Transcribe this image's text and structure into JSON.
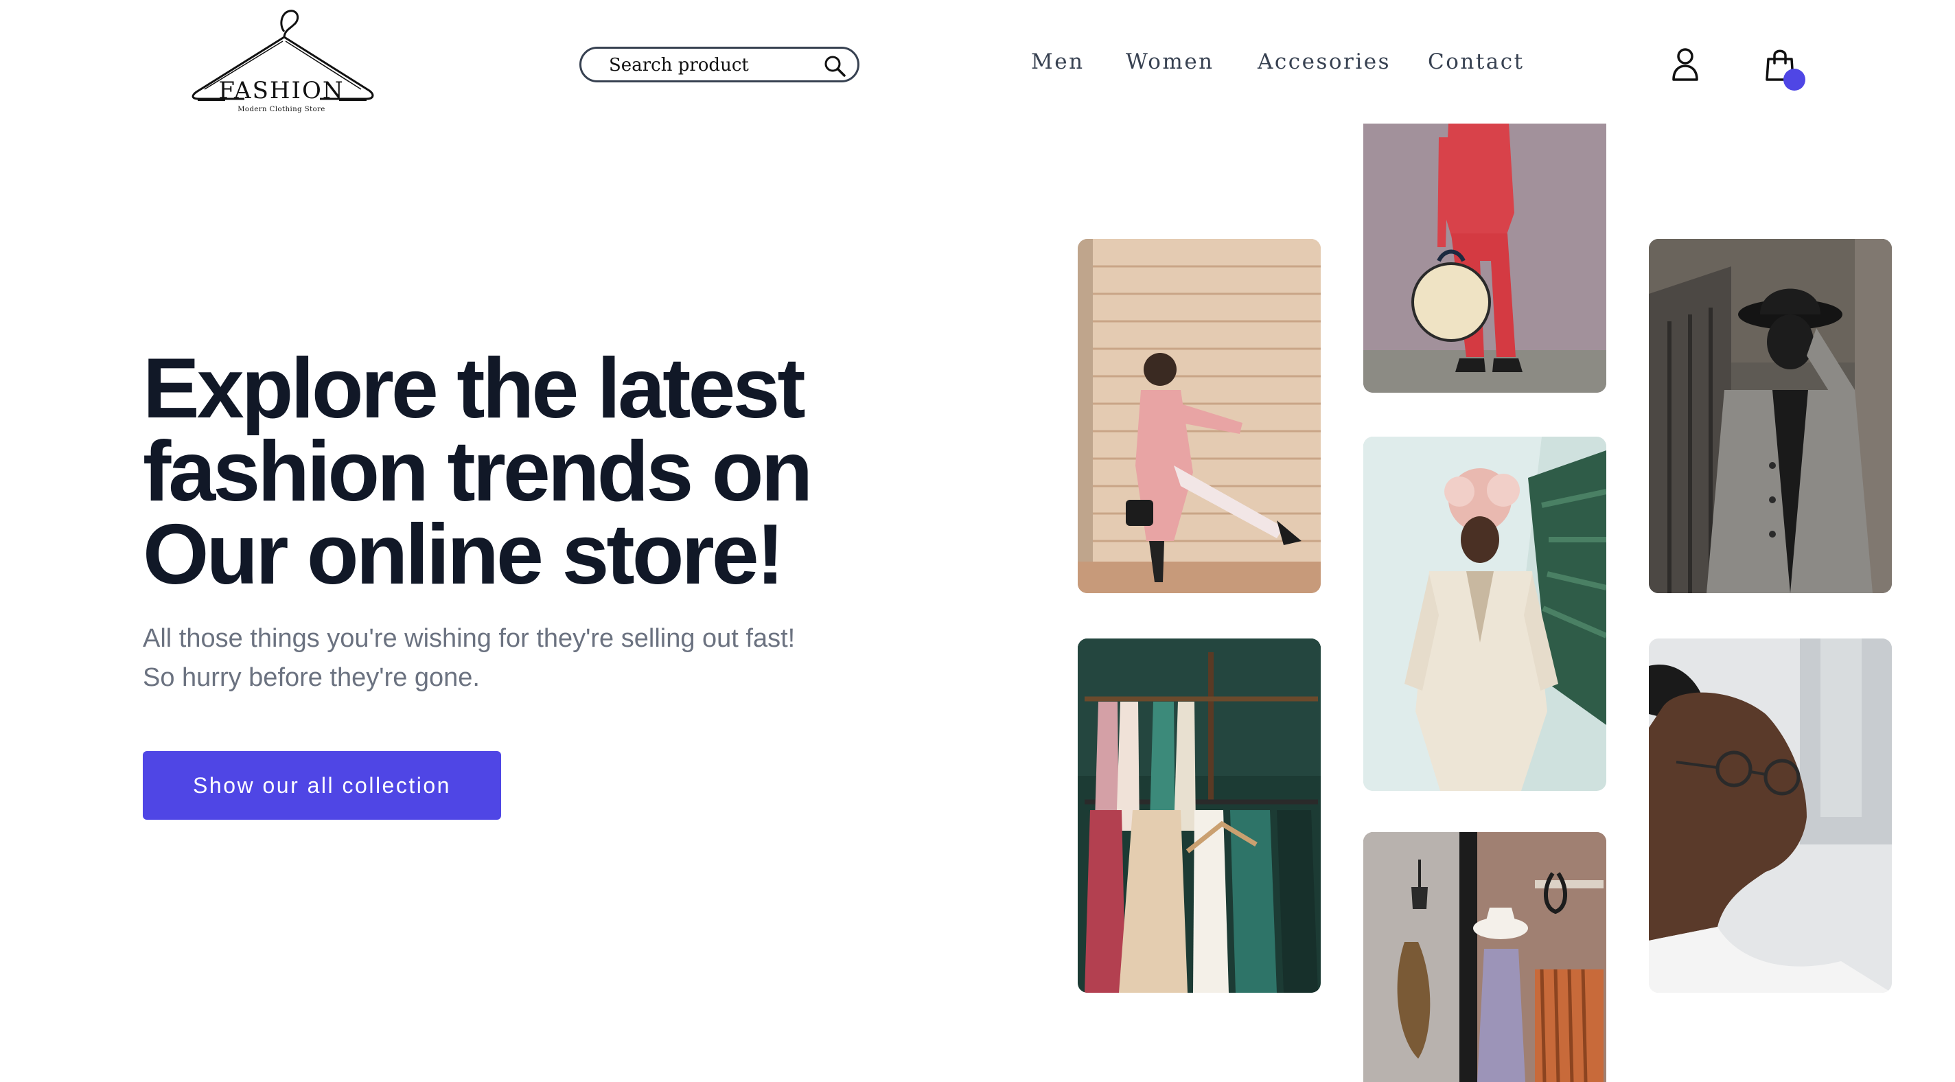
{
  "brand": {
    "name": "FASHION",
    "tagline": "Modern Clothing Store",
    "logo_icon": "hanger-icon"
  },
  "search": {
    "placeholder": "Search product",
    "icon": "search-icon"
  },
  "nav": {
    "items": [
      {
        "label": "Men"
      },
      {
        "label": "Women"
      },
      {
        "label": "Accesories"
      },
      {
        "label": "Contact"
      }
    ]
  },
  "header_icons": {
    "user": "user-icon",
    "cart": "shopping-bag-icon",
    "cart_badge_color": "#4f46e5"
  },
  "hero": {
    "title_lines": [
      "Explore the latest",
      "fashion trends on",
      "Our online store!"
    ],
    "subtitle_lines": [
      "All those things you're wishing for they're selling out fast!",
      "So hurry before they're gone."
    ],
    "cta_label": "Show our all collection"
  },
  "colors": {
    "accent": "#4f46e5",
    "heading": "#111827",
    "muted_text": "#6b7280"
  },
  "gallery": [
    {
      "subject": "woman in pink coat kicking against striped wall"
    },
    {
      "subject": "person in red suit holding round straw bag"
    },
    {
      "subject": "person in grey coat covering face with black hat"
    },
    {
      "subject": "clothing rack with dresses and wooden hangers"
    },
    {
      "subject": "person in white suit with pink floral headpiece"
    },
    {
      "subject": "man with glasses looking upward"
    },
    {
      "subject": "boutique interior with hat and hanging bag"
    }
  ]
}
